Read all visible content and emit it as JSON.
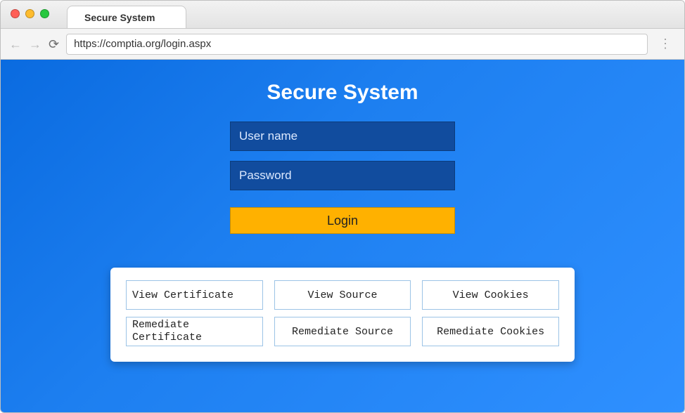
{
  "browser": {
    "tab_title": "Secure System",
    "url": "https://comptia.org/login.aspx"
  },
  "page": {
    "heading": "Secure System",
    "username_placeholder": "User name",
    "password_placeholder": "Password",
    "login_label": "Login"
  },
  "actions": {
    "view_certificate": "View Certificate",
    "view_source": "View Source",
    "view_cookies": "View Cookies",
    "remediate_certificate": "Remediate\nCertificate",
    "remediate_source": "Remediate Source",
    "remediate_cookies": "Remediate Cookies"
  }
}
